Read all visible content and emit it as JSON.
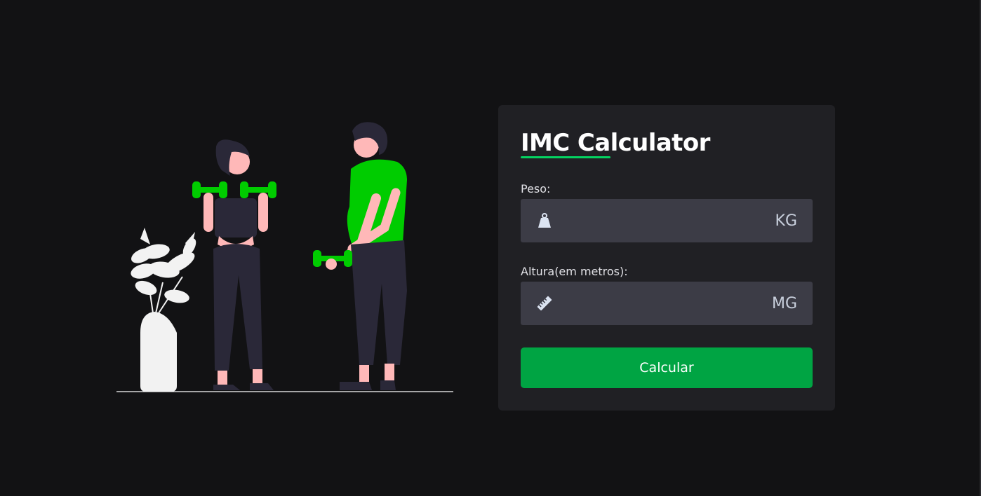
{
  "card": {
    "title": "IMC Calculator",
    "weight": {
      "label": "Peso:",
      "value": "",
      "unit": "KG",
      "icon": "weight-icon"
    },
    "height": {
      "label": "Altura(em metros):",
      "value": "",
      "unit": "MG",
      "icon": "ruler-icon"
    },
    "submit_label": "Calcular"
  },
  "colors": {
    "background": "#121214",
    "card": "#202024",
    "input": "#3c3c46",
    "accent": "#04d361",
    "button": "#00a443",
    "figure_dark": "#2a2838",
    "skin": "#ffb8b8"
  }
}
